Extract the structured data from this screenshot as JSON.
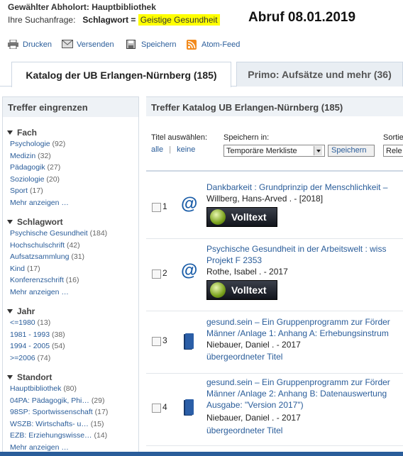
{
  "header": {
    "pickup_label": "Gewählter Abholort: Hauptbibliothek",
    "query_prefix": "Ihre Suchanfrage:",
    "query_field": "Schlagwort =",
    "query_value": "Geistige Gesundheit",
    "annotation": "Abruf 08.01.2019"
  },
  "toolbar": {
    "print": "Drucken",
    "send": "Versenden",
    "save": "Speichern",
    "feed": "Atom-Feed"
  },
  "tabs": [
    {
      "label": "Katalog der UB Erlangen-Nürnberg (185)",
      "active": true
    },
    {
      "label": "Primo: Aufsätze und mehr (36)",
      "active": false
    }
  ],
  "sidebar": {
    "title": "Treffer eingrenzen",
    "groups": [
      {
        "title": "Fach",
        "items": [
          {
            "label": "Psychologie",
            "count": "(92)"
          },
          {
            "label": "Medizin",
            "count": "(32)"
          },
          {
            "label": "Pädagogik",
            "count": "(27)"
          },
          {
            "label": "Soziologie",
            "count": "(20)"
          },
          {
            "label": "Sport",
            "count": "(17)"
          },
          {
            "label": "Mehr anzeigen …",
            "count": ""
          }
        ]
      },
      {
        "title": "Schlagwort",
        "items": [
          {
            "label": "Psychische Gesundheit",
            "count": "(184)"
          },
          {
            "label": "Hochschulschrift",
            "count": "(42)"
          },
          {
            "label": "Aufsatzsammlung",
            "count": "(31)"
          },
          {
            "label": "Kind",
            "count": "(17)"
          },
          {
            "label": "Konferenzschrift",
            "count": "(16)"
          },
          {
            "label": "Mehr anzeigen …",
            "count": ""
          }
        ]
      },
      {
        "title": "Jahr",
        "items": [
          {
            "label": "<=1980",
            "count": "(13)"
          },
          {
            "label": "1981 - 1993",
            "count": "(38)"
          },
          {
            "label": "1994 - 2005",
            "count": "(54)"
          },
          {
            "label": ">=2006",
            "count": "(74)"
          }
        ]
      },
      {
        "title": "Standort",
        "items": [
          {
            "label": "Hauptbibliothek",
            "count": "(80)"
          },
          {
            "label": "04PA: Pädagogik, Phi…",
            "count": "(29)"
          },
          {
            "label": "98SP: Sportwissenschaft",
            "count": "(17)"
          },
          {
            "label": "WSZB: Wirtschafts- u…",
            "count": "(15)"
          },
          {
            "label": "EZB: Erziehungswisse…",
            "count": "(14)"
          },
          {
            "label": "Mehr anzeigen …",
            "count": ""
          }
        ]
      }
    ]
  },
  "results": {
    "title": "Treffer Katalog UB Erlangen-Nürnberg (185)",
    "select_label": "Titel auswählen:",
    "select_all": "alle",
    "select_none": "keine",
    "save_in_label": "Speichern in:",
    "save_in_value": "Temporäre Merkliste",
    "save_button": "Speichern",
    "sort_label": "Sortie",
    "sort_value": "Rele",
    "fulltext_label": "Volltext",
    "items": [
      {
        "num": "1",
        "title_lines": [
          "Dankbarkeit : Grundprinzip der Menschlichkeit –"
        ],
        "author": "Willberg, Hans-Arved . - [2018]",
        "icon": "at-icon",
        "fulltext": true,
        "parent": ""
      },
      {
        "num": "2",
        "title_lines": [
          "Psychische Gesundheit in der Arbeitswelt : wiss",
          "Projekt F 2353"
        ],
        "author": "Rothe, Isabel . - 2017",
        "icon": "at-icon",
        "fulltext": true,
        "parent": ""
      },
      {
        "num": "3",
        "title_lines": [
          "gesund.sein – Ein Gruppenprogramm zur Förder",
          "Männer /Anlage 1: Anhang A: Erhebungsinstrum"
        ],
        "author": "Niebauer, Daniel . - 2017",
        "icon": "book-icon",
        "fulltext": false,
        "parent": "übergeordneter Titel"
      },
      {
        "num": "4",
        "title_lines": [
          "gesund.sein – Ein Gruppenprogramm zur Förder",
          "Männer /Anlage 2: Anhang B: Datenauswertung",
          "Ausgabe: \"Version 2017\")"
        ],
        "author": "Niebauer, Daniel . - 2017",
        "icon": "book-icon",
        "fulltext": false,
        "parent": "übergeordneter Titel"
      }
    ]
  },
  "colors": {
    "link": "#2a5d9a",
    "highlight": "#ffff00",
    "panel": "#eef2f6"
  }
}
